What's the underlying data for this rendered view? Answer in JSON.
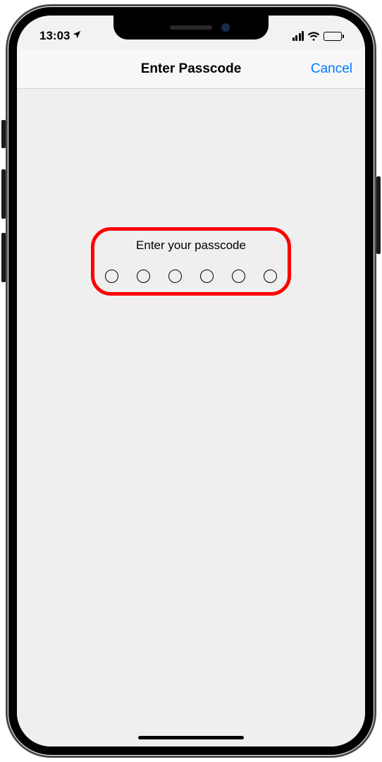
{
  "statusBar": {
    "time": "13:03"
  },
  "navBar": {
    "title": "Enter Passcode",
    "cancel": "Cancel"
  },
  "passcode": {
    "prompt": "Enter your passcode",
    "digitCount": 6
  }
}
